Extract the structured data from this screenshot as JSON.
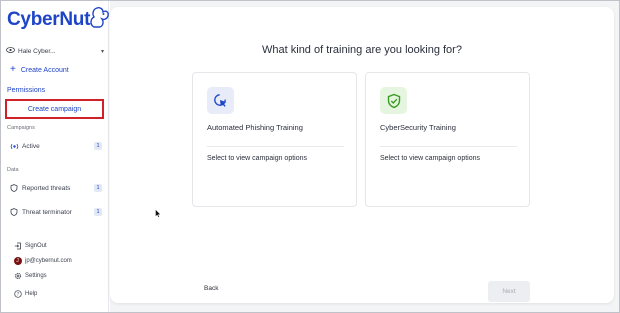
{
  "brand": {
    "name": "CyberNut"
  },
  "sidebar": {
    "org_selector": {
      "label": "Hale Cyber..."
    },
    "create_account_label": "Create Account",
    "permissions_label": "Permissions",
    "create_campaign_label": "Create campaign",
    "campaigns_section": "Campaigns",
    "campaign_items": [
      {
        "label": "Active",
        "count": "1",
        "icon": "broadcast-icon"
      }
    ],
    "data_section": "Data",
    "data_items": [
      {
        "label": "Reported threats",
        "count": "1",
        "icon": "shield-icon"
      },
      {
        "label": "Threat terminator",
        "count": "1",
        "icon": "shield-icon"
      }
    ],
    "footer_items": [
      {
        "label": "SignOut",
        "icon": "signout-icon"
      },
      {
        "label": "jp@cybernut.com",
        "icon": "avatar",
        "avatar_letter": "J"
      },
      {
        "label": "Settings",
        "icon": "gear-icon"
      },
      {
        "label": "Help",
        "icon": "help-icon"
      }
    ]
  },
  "main": {
    "title": "What kind of training are you looking for?",
    "cards": [
      {
        "title": "Automated Phishing Training",
        "subtitle": "Select to view campaign options",
        "icon": "cursor-click-icon",
        "icon_bg": "#e7ecf8",
        "icon_color": "#1e44c7"
      },
      {
        "title": "CyberSecurity Training",
        "subtitle": "Select to view campaign options",
        "icon": "shield-check-icon",
        "icon_bg": "#e6f5df",
        "icon_color": "#3a9b22"
      }
    ],
    "back_label": "Back",
    "next_label": "Next"
  },
  "colors": {
    "accent": "#1e44c7",
    "highlight_border": "#d0212a",
    "background": "#f3f4f6"
  }
}
